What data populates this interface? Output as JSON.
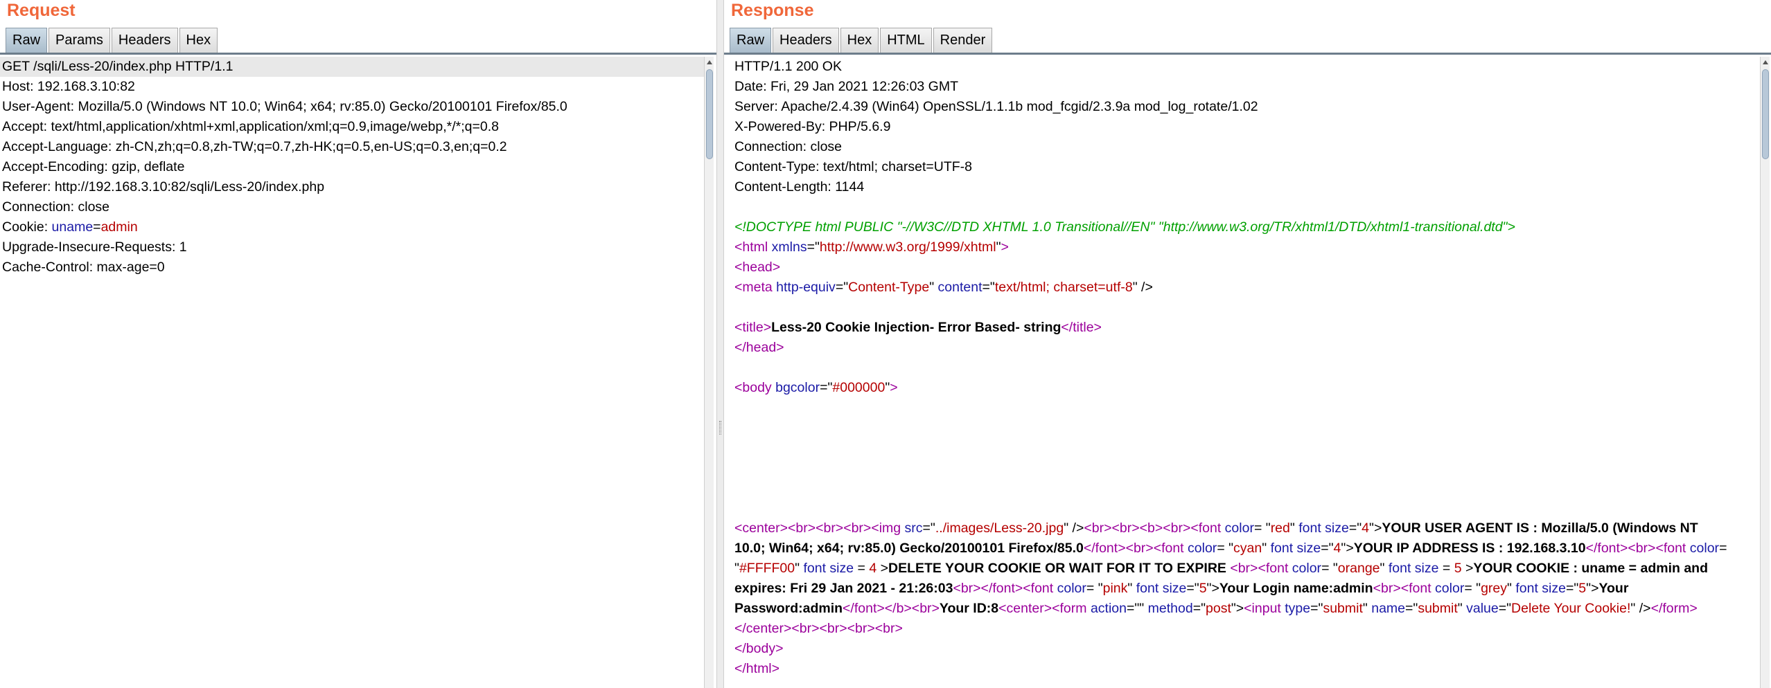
{
  "request": {
    "title": "Request",
    "tabs": [
      "Raw",
      "Params",
      "Headers",
      "Hex"
    ],
    "lines": [
      "GET /sqli/Less-20/index.php HTTP/1.1",
      "Host: 192.168.3.10:82",
      "User-Agent: Mozilla/5.0 (Windows NT 10.0; Win64; x64; rv:85.0) Gecko/20100101 Firefox/85.0",
      "Accept: text/html,application/xhtml+xml,application/xml;q=0.9,image/webp,*/*;q=0.8",
      "Accept-Language: zh-CN,zh;q=0.8,zh-TW;q=0.7,zh-HK;q=0.5,en-US;q=0.3,en;q=0.2",
      "Accept-Encoding: gzip, deflate",
      "Referer: http://192.168.3.10:82/sqli/Less-20/index.php",
      "Connection: close"
    ],
    "cookie_prefix": "Cookie: ",
    "cookie_key": "uname",
    "cookie_eq": "=",
    "cookie_value": "admin",
    "lines_after": [
      "Upgrade-Insecure-Requests: 1",
      "Cache-Control: max-age=0"
    ]
  },
  "response": {
    "title": "Response",
    "tabs": [
      "Raw",
      "Headers",
      "Hex",
      "HTML",
      "Render"
    ],
    "headers": [
      "HTTP/1.1 200 OK",
      "Date: Fri, 29 Jan 2021 12:26:03 GMT",
      "Server: Apache/2.4.39 (Win64) OpenSSL/1.1.1b mod_fcgid/2.3.9a mod_log_rotate/1.02",
      "X-Powered-By: PHP/5.6.9",
      "Connection: close",
      "Content-Type: text/html; charset=UTF-8",
      "Content-Length: 1144"
    ],
    "doctype": "<!DOCTYPE html PUBLIC \"-//W3C//DTD XHTML 1.0 Transitional//EN\" \"http://www.w3.org/TR/xhtml1/DTD/xhtml1-transitional.dtd\">",
    "page_title_text": "Less-20 Cookie Injection- Error Based- string",
    "body_bgcolor": "#000000",
    "center_html": [
      {
        "t": "tag",
        "v": "<center><br><br><br><img "
      },
      {
        "t": "attr",
        "v": "src"
      },
      {
        "t": "plain",
        "v": "=\""
      },
      {
        "t": "val",
        "v": "../images/Less-20.jpg"
      },
      {
        "t": "plain",
        "v": "\" />"
      },
      {
        "t": "tag",
        "v": "<br><br><b><br><font "
      },
      {
        "t": "attr",
        "v": "color"
      },
      {
        "t": "plain",
        "v": "= \""
      },
      {
        "t": "val",
        "v": "red"
      },
      {
        "t": "plain",
        "v": "\" "
      },
      {
        "t": "attr",
        "v": "font size"
      },
      {
        "t": "plain",
        "v": "=\""
      },
      {
        "t": "val",
        "v": "4"
      },
      {
        "t": "plain",
        "v": "\">"
      },
      {
        "t": "bold",
        "v": "YOUR USER AGENT IS : Mozilla/5.0 (Windows NT 10.0; Win64; x64; rv:85.0) Gecko/20100101 Firefox/85.0"
      },
      {
        "t": "tag",
        "v": "</font><br><font "
      },
      {
        "t": "attr",
        "v": "color"
      },
      {
        "t": "plain",
        "v": "= \""
      },
      {
        "t": "val",
        "v": "cyan"
      },
      {
        "t": "plain",
        "v": "\" "
      },
      {
        "t": "attr",
        "v": "font size"
      },
      {
        "t": "plain",
        "v": "=\""
      },
      {
        "t": "val",
        "v": "4"
      },
      {
        "t": "plain",
        "v": "\">"
      },
      {
        "t": "bold",
        "v": "YOUR IP ADDRESS IS : 192.168.3.10"
      },
      {
        "t": "tag",
        "v": "</font><br><font "
      },
      {
        "t": "attr",
        "v": "color"
      },
      {
        "t": "plain",
        "v": "= \""
      },
      {
        "t": "val",
        "v": "#FFFF00"
      },
      {
        "t": "plain",
        "v": "\" "
      },
      {
        "t": "attr",
        "v": "font size"
      },
      {
        "t": "plain",
        "v": " = "
      },
      {
        "t": "val",
        "v": "4"
      },
      {
        "t": "plain",
        "v": " >"
      },
      {
        "t": "bold",
        "v": "DELETE YOUR COOKIE OR WAIT FOR IT TO EXPIRE "
      },
      {
        "t": "tag",
        "v": "<br><font "
      },
      {
        "t": "attr",
        "v": "color"
      },
      {
        "t": "plain",
        "v": "= \""
      },
      {
        "t": "val",
        "v": "orange"
      },
      {
        "t": "plain",
        "v": "\" "
      },
      {
        "t": "attr",
        "v": "font size"
      },
      {
        "t": "plain",
        "v": " = "
      },
      {
        "t": "val",
        "v": "5"
      },
      {
        "t": "plain",
        "v": " >"
      },
      {
        "t": "bold",
        "v": "YOUR COOKIE : uname = admin and expires: Fri 29 Jan 2021 - 21:26:03"
      },
      {
        "t": "tag",
        "v": "<br></font><font "
      },
      {
        "t": "attr",
        "v": "color"
      },
      {
        "t": "plain",
        "v": "= \""
      },
      {
        "t": "val",
        "v": "pink"
      },
      {
        "t": "plain",
        "v": "\" "
      },
      {
        "t": "attr",
        "v": "font size"
      },
      {
        "t": "plain",
        "v": "=\""
      },
      {
        "t": "val",
        "v": "5"
      },
      {
        "t": "plain",
        "v": "\">"
      },
      {
        "t": "bold",
        "v": "Your Login name:admin"
      },
      {
        "t": "tag",
        "v": "<br><font "
      },
      {
        "t": "attr",
        "v": "color"
      },
      {
        "t": "plain",
        "v": "= \""
      },
      {
        "t": "val",
        "v": "grey"
      },
      {
        "t": "plain",
        "v": "\" "
      },
      {
        "t": "attr",
        "v": "font size"
      },
      {
        "t": "plain",
        "v": "=\""
      },
      {
        "t": "val",
        "v": "5"
      },
      {
        "t": "plain",
        "v": "\">"
      },
      {
        "t": "bold",
        "v": "Your Password:admin"
      },
      {
        "t": "tag",
        "v": "</font></b><br>"
      },
      {
        "t": "bold",
        "v": "Your ID:8"
      },
      {
        "t": "tag",
        "v": "<center><form "
      },
      {
        "t": "attr",
        "v": "action"
      },
      {
        "t": "plain",
        "v": "=\"\" "
      },
      {
        "t": "attr",
        "v": "method"
      },
      {
        "t": "plain",
        "v": "=\""
      },
      {
        "t": "val",
        "v": "post"
      },
      {
        "t": "plain",
        "v": "\">"
      },
      {
        "t": "tag",
        "v": "<input  "
      },
      {
        "t": "attr",
        "v": "type"
      },
      {
        "t": "plain",
        "v": "=\""
      },
      {
        "t": "val",
        "v": "submit"
      },
      {
        "t": "plain",
        "v": "\" "
      },
      {
        "t": "attr",
        "v": "name"
      },
      {
        "t": "plain",
        "v": "=\""
      },
      {
        "t": "val",
        "v": "submit"
      },
      {
        "t": "plain",
        "v": "\" "
      },
      {
        "t": "attr",
        "v": "value"
      },
      {
        "t": "plain",
        "v": "=\""
      },
      {
        "t": "val",
        "v": "Delete Your Cookie!"
      },
      {
        "t": "plain",
        "v": "\" />"
      },
      {
        "t": "tag",
        "v": "</form></center><br><br><br><br>"
      }
    ],
    "closing": [
      "</body>",
      "</html>"
    ]
  }
}
